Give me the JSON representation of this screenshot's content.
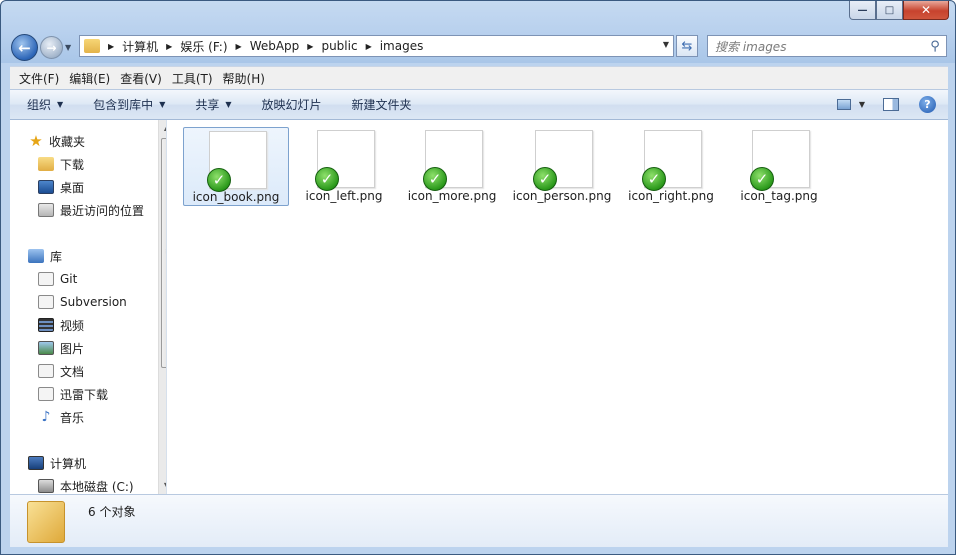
{
  "window": {
    "caption": {
      "minimize": "—",
      "maximize": "□",
      "close": "✕"
    }
  },
  "address": {
    "crumbs": [
      "计算机",
      "娱乐 (F:)",
      "WebApp",
      "public",
      "images"
    ],
    "search_placeholder": "搜索 images"
  },
  "menu": [
    "文件(F)",
    "编辑(E)",
    "查看(V)",
    "工具(T)",
    "帮助(H)"
  ],
  "toolbar": {
    "organize": "组织",
    "include_in_library": "包含到库中",
    "share": "共享",
    "slideshow": "放映幻灯片",
    "new_folder": "新建文件夹",
    "help": "?"
  },
  "sidebar": {
    "favorites": {
      "label": "收藏夹",
      "items": [
        "下载",
        "桌面",
        "最近访问的位置"
      ]
    },
    "libraries": {
      "label": "库",
      "items": [
        "Git",
        "Subversion",
        "视频",
        "图片",
        "文档",
        "迅雷下载",
        "音乐"
      ]
    },
    "computer": {
      "label": "计算机",
      "items": [
        "本地磁盘 (C:)"
      ]
    }
  },
  "files": [
    {
      "name": "icon_book.png",
      "selected": true
    },
    {
      "name": "icon_left.png",
      "selected": false
    },
    {
      "name": "icon_more.png",
      "selected": false
    },
    {
      "name": "icon_person.png",
      "selected": false
    },
    {
      "name": "icon_right.png",
      "selected": false
    },
    {
      "name": "icon_tag.png",
      "selected": false
    }
  ],
  "status": {
    "count_text": "6 个对象"
  },
  "colors": {
    "accent": "#2d66b8",
    "check_green": "#2c9a1c",
    "selection": "#dceafa"
  }
}
